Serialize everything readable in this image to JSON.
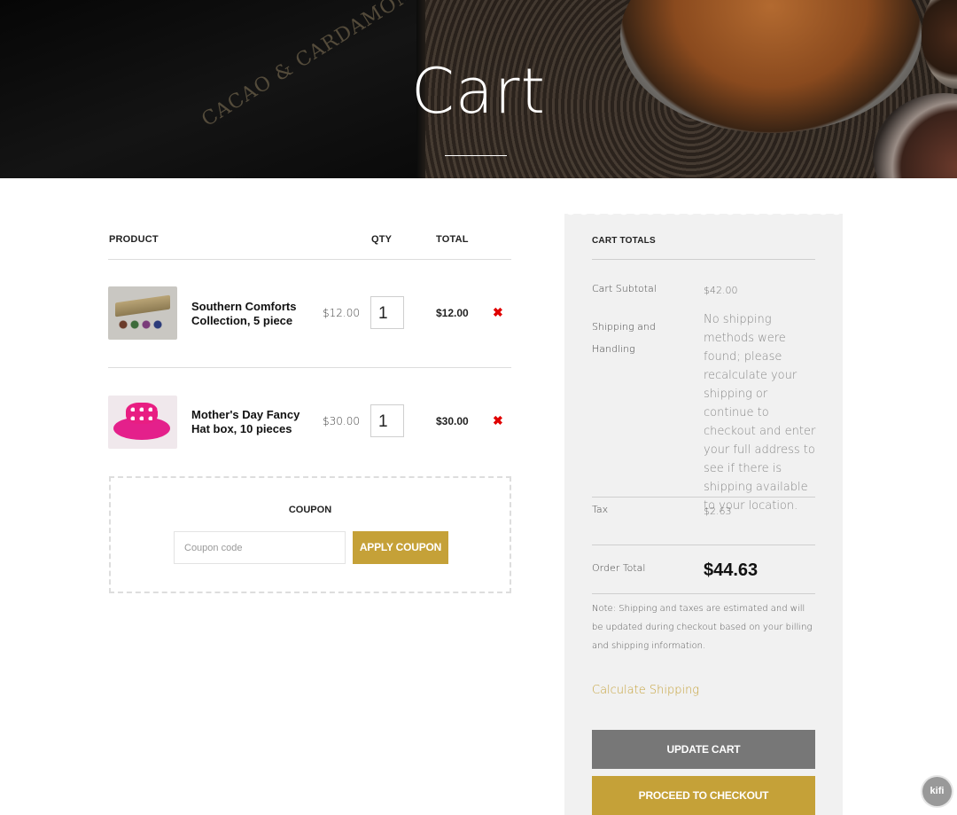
{
  "hero": {
    "title": "Cart",
    "brand_text": "CACAO & CARDAMOM"
  },
  "cart": {
    "headers": {
      "product": "PRODUCT",
      "qty": "QTY",
      "total": "TOTAL"
    },
    "items": [
      {
        "name": "Southern Comforts Collection, 5 piece",
        "price": "$12.00",
        "qty": "1",
        "total": "$12.00",
        "remove_icon": "red-x-icon"
      },
      {
        "name": "Mother's Day Fancy Hat box, 10 pieces",
        "price": "$30.00",
        "qty": "1",
        "total": "$30.00",
        "remove_icon": "red-x-icon"
      }
    ]
  },
  "coupon": {
    "label": "COUPON",
    "placeholder": "Coupon code",
    "value": "",
    "apply_label": "APPLY COUPON"
  },
  "totals": {
    "title": "CART TOTALS",
    "subtotal_label": "Cart Subtotal",
    "subtotal_value": "$42.00",
    "shipping_label": "Shipping and Handling",
    "shipping_value": "No shipping methods were found; please recalculate your shipping or continue to checkout and enter your full address to see if there is shipping available to your location.",
    "tax_label": "Tax",
    "tax_value": "$2.63",
    "order_total_label": "Order Total",
    "order_total_value": "$44.63",
    "note": "Note: Shipping and taxes are estimated and will be updated during checkout based on your billing and shipping information.",
    "calc_shipping": "Calculate Shipping",
    "update_cart": "UPDATE CART",
    "checkout": "PROCEED TO CHECKOUT"
  },
  "widget": {
    "label": "kifi"
  },
  "colors": {
    "accent": "#c5a138",
    "remove": "#e00000",
    "update_button": "#777777",
    "panel": "#f1f1f1"
  }
}
